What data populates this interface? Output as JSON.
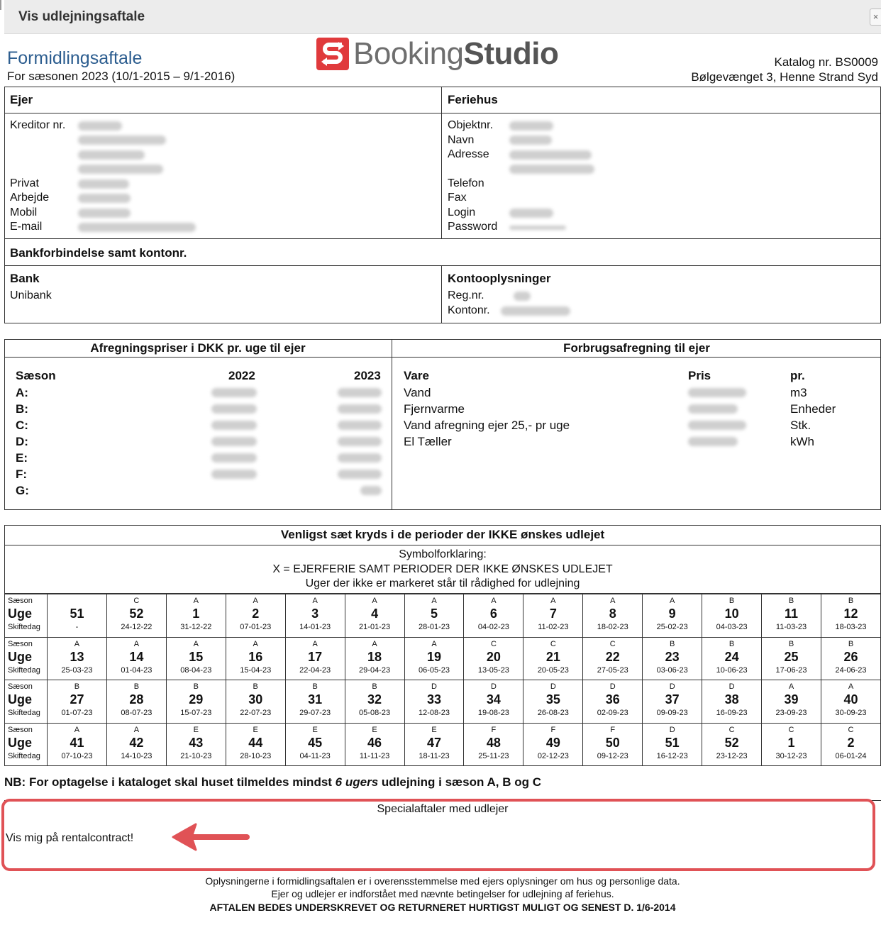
{
  "window": {
    "title": "Vis udlejningsaftale",
    "close_glyph": "×"
  },
  "header": {
    "doc_title": "Formidlingsaftale",
    "season": "For sæsonen 2023 (10/1-2015 – 9/1-2016)",
    "logo": {
      "prefix": "Booking",
      "suffix": "Studio"
    },
    "catalog": "Katalog nr. BS0009",
    "address": "Bølgevænget 3, Henne Strand Syd"
  },
  "owner": {
    "heading": "Ejer",
    "creditor_label": "Kreditor nr.",
    "private_label": "Privat",
    "work_label": "Arbejde",
    "mobile_label": "Mobil",
    "email_label": "E-mail"
  },
  "house": {
    "heading": "Feriehus",
    "object_label": "Objektnr.",
    "name_label": "Navn",
    "address_label": "Adresse",
    "phone_label": "Telefon",
    "fax_label": "Fax",
    "login_label": "Login",
    "password_label": "Password"
  },
  "bank_section": {
    "heading": "Bankforbindelse samt kontonr.",
    "bank_heading": "Bank",
    "bank_name": "Unibank",
    "account_heading": "Kontooplysninger",
    "reg_label": "Reg.nr.",
    "account_label": "Kontonr."
  },
  "prices": {
    "heading": "Afregningspriser i DKK pr. uge til ejer",
    "season_header": "Sæson",
    "year1": "2022",
    "year2": "2023",
    "seasons": [
      "A:",
      "B:",
      "C:",
      "D:",
      "E:",
      "F:",
      "G:"
    ]
  },
  "consumption": {
    "heading": "Forbrugsafregning til ejer",
    "item_header": "Vare",
    "price_header": "Pris",
    "unit_header": "pr.",
    "items": [
      "Vand",
      "Fjernvarme",
      "Vand afregning ejer 25,- pr uge",
      "El Tæller"
    ],
    "units": [
      "m3",
      "Enheder",
      "Stk.",
      "kWh"
    ]
  },
  "calendar": {
    "heading": "Venligst sæt kryds i de perioder der IKKE ønskes udlejet",
    "legend": [
      "Symbolforklaring:",
      "X = EJERFERIE SAMT PERIODER DER IKKE ØNSKES UDLEJET",
      "Uger der ikke er markeret står til rådighed for udlejning"
    ],
    "row_labels": {
      "season": "Sæson",
      "week": "Uge",
      "changeday": "Skiftedag"
    },
    "rows": [
      [
        {
          "s": "",
          "w": "51",
          "d": "-"
        },
        {
          "s": "C",
          "w": "52",
          "d": "24-12-22"
        },
        {
          "s": "A",
          "w": "1",
          "d": "31-12-22"
        },
        {
          "s": "A",
          "w": "2",
          "d": "07-01-23"
        },
        {
          "s": "A",
          "w": "3",
          "d": "14-01-23"
        },
        {
          "s": "A",
          "w": "4",
          "d": "21-01-23"
        },
        {
          "s": "A",
          "w": "5",
          "d": "28-01-23"
        },
        {
          "s": "A",
          "w": "6",
          "d": "04-02-23"
        },
        {
          "s": "A",
          "w": "7",
          "d": "11-02-23"
        },
        {
          "s": "A",
          "w": "8",
          "d": "18-02-23"
        },
        {
          "s": "A",
          "w": "9",
          "d": "25-02-23"
        },
        {
          "s": "B",
          "w": "10",
          "d": "04-03-23"
        },
        {
          "s": "B",
          "w": "11",
          "d": "11-03-23"
        },
        {
          "s": "B",
          "w": "12",
          "d": "18-03-23"
        }
      ],
      [
        {
          "s": "A",
          "w": "13",
          "d": "25-03-23"
        },
        {
          "s": "A",
          "w": "14",
          "d": "01-04-23"
        },
        {
          "s": "A",
          "w": "15",
          "d": "08-04-23"
        },
        {
          "s": "A",
          "w": "16",
          "d": "15-04-23"
        },
        {
          "s": "A",
          "w": "17",
          "d": "22-04-23"
        },
        {
          "s": "A",
          "w": "18",
          "d": "29-04-23"
        },
        {
          "s": "A",
          "w": "19",
          "d": "06-05-23"
        },
        {
          "s": "C",
          "w": "20",
          "d": "13-05-23"
        },
        {
          "s": "C",
          "w": "21",
          "d": "20-05-23"
        },
        {
          "s": "C",
          "w": "22",
          "d": "27-05-23"
        },
        {
          "s": "B",
          "w": "23",
          "d": "03-06-23"
        },
        {
          "s": "B",
          "w": "24",
          "d": "10-06-23"
        },
        {
          "s": "B",
          "w": "25",
          "d": "17-06-23"
        },
        {
          "s": "B",
          "w": "26",
          "d": "24-06-23"
        }
      ],
      [
        {
          "s": "B",
          "w": "27",
          "d": "01-07-23"
        },
        {
          "s": "B",
          "w": "28",
          "d": "08-07-23"
        },
        {
          "s": "B",
          "w": "29",
          "d": "15-07-23"
        },
        {
          "s": "B",
          "w": "30",
          "d": "22-07-23"
        },
        {
          "s": "B",
          "w": "31",
          "d": "29-07-23"
        },
        {
          "s": "B",
          "w": "32",
          "d": "05-08-23"
        },
        {
          "s": "D",
          "w": "33",
          "d": "12-08-23"
        },
        {
          "s": "D",
          "w": "34",
          "d": "19-08-23"
        },
        {
          "s": "D",
          "w": "35",
          "d": "26-08-23"
        },
        {
          "s": "D",
          "w": "36",
          "d": "02-09-23"
        },
        {
          "s": "D",
          "w": "37",
          "d": "09-09-23"
        },
        {
          "s": "D",
          "w": "38",
          "d": "16-09-23"
        },
        {
          "s": "A",
          "w": "39",
          "d": "23-09-23"
        },
        {
          "s": "A",
          "w": "40",
          "d": "30-09-23"
        }
      ],
      [
        {
          "s": "A",
          "w": "41",
          "d": "07-10-23"
        },
        {
          "s": "A",
          "w": "42",
          "d": "14-10-23"
        },
        {
          "s": "E",
          "w": "43",
          "d": "21-10-23"
        },
        {
          "s": "E",
          "w": "44",
          "d": "28-10-23"
        },
        {
          "s": "E",
          "w": "45",
          "d": "04-11-23"
        },
        {
          "s": "E",
          "w": "46",
          "d": "11-11-23"
        },
        {
          "s": "E",
          "w": "47",
          "d": "18-11-23"
        },
        {
          "s": "F",
          "w": "48",
          "d": "25-11-23"
        },
        {
          "s": "F",
          "w": "49",
          "d": "02-12-23"
        },
        {
          "s": "F",
          "w": "50",
          "d": "09-12-23"
        },
        {
          "s": "D",
          "w": "51",
          "d": "16-12-23"
        },
        {
          "s": "C",
          "w": "52",
          "d": "23-12-23"
        },
        {
          "s": "C",
          "w": "1",
          "d": "30-12-23"
        },
        {
          "s": "C",
          "w": "2",
          "d": "06-01-24"
        }
      ]
    ]
  },
  "nb": {
    "before": "NB: For optagelse i kataloget skal huset tilmeldes mindst ",
    "emph": "6 ugers",
    "after": " udlejning i sæson A, B og C"
  },
  "special": {
    "title": "Specialaftaler med udlejer",
    "text": "Vis mig på rentalcontract!"
  },
  "footer": {
    "line1": "Oplysningerne i formidlingsaftalen er i overensstemmelse med ejers oplysninger om hus og personlige data.",
    "line2": "Ejer og udlejer er indforstået med nævnte betingelser for udlejning af feriehus.",
    "line3": "AFTALEN BEDES UNDERSKREVET OG RETURNERET HURTIGST MULIGT OG SENEST D. 1/6-2014"
  },
  "colors": {
    "title_blue": "#2c5d8f",
    "logo_red": "#e03a3c",
    "highlight": "#e05256"
  },
  "icons": {
    "close": "close-icon",
    "logo": "bookingstudio-logo",
    "arrow": "arrow-left-icon"
  }
}
